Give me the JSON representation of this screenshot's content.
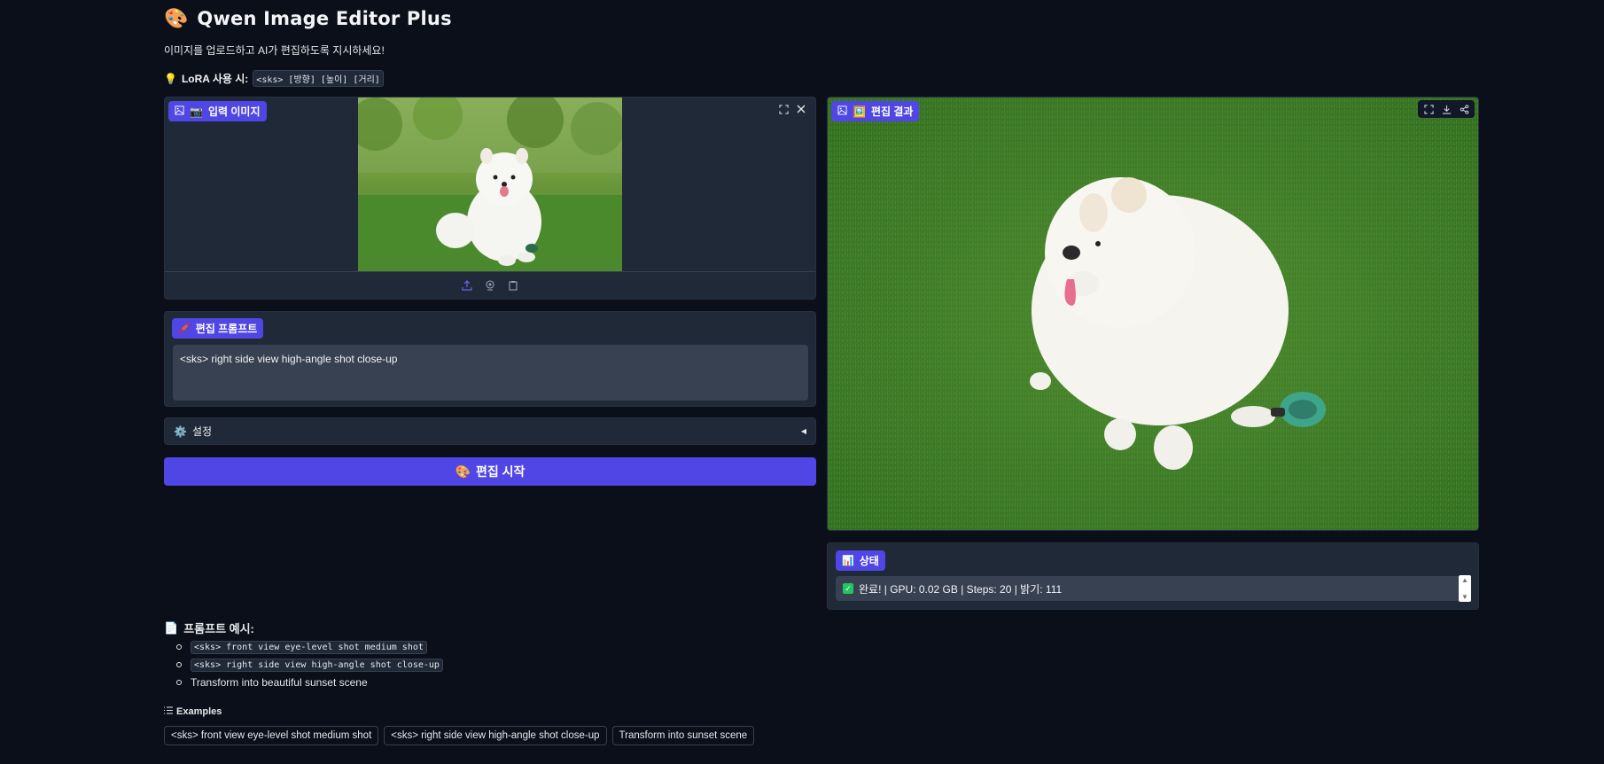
{
  "header": {
    "emoji": "🎨",
    "title": "Qwen Image Editor Plus",
    "subtitle": "이미지를 업로드하고 AI가 편집하도록 지시하세요!",
    "tip_emoji": "💡",
    "tip_label": "LoRA 사용 시:",
    "tip_code": "<sks> [방향] [높이] [거리]"
  },
  "input_panel": {
    "badge_icon": "📷",
    "badge_label": "입력 이미지",
    "tools": [
      "fullscreen-icon",
      "close-icon"
    ],
    "bottom_tools": [
      "upload-icon",
      "webcam-icon",
      "clipboard-icon"
    ]
  },
  "prompt": {
    "badge_icon": "🖍️",
    "badge_label": "편집 프롬프트",
    "value": "<sks> right side view high-angle shot close-up"
  },
  "settings": {
    "icon": "⚙️",
    "label": "설정",
    "arrow": "◀"
  },
  "run_button": {
    "icon": "🎨",
    "label": "편집 시작"
  },
  "output_panel": {
    "badge_icon": "🖼️",
    "badge_label": "편집 결과",
    "tools": [
      "fullscreen-icon",
      "download-icon",
      "share-icon"
    ]
  },
  "status": {
    "badge_icon": "📊",
    "badge_label": "상태",
    "text": "완료! | GPU: 0.02 GB | Steps: 20 | 밝기: 111"
  },
  "prompt_examples": {
    "icon": "📄",
    "heading": "프롬프트 예시:",
    "items": [
      "<sks> front view eye-level shot medium shot",
      "<sks> right side view high-angle shot close-up",
      "Transform into beautiful sunset scene"
    ]
  },
  "examples": {
    "heading": "Examples",
    "buttons": [
      "<sks> front view eye-level shot medium shot",
      "<sks> right side view high-angle shot close-up",
      "Transform into sunset scene"
    ]
  }
}
